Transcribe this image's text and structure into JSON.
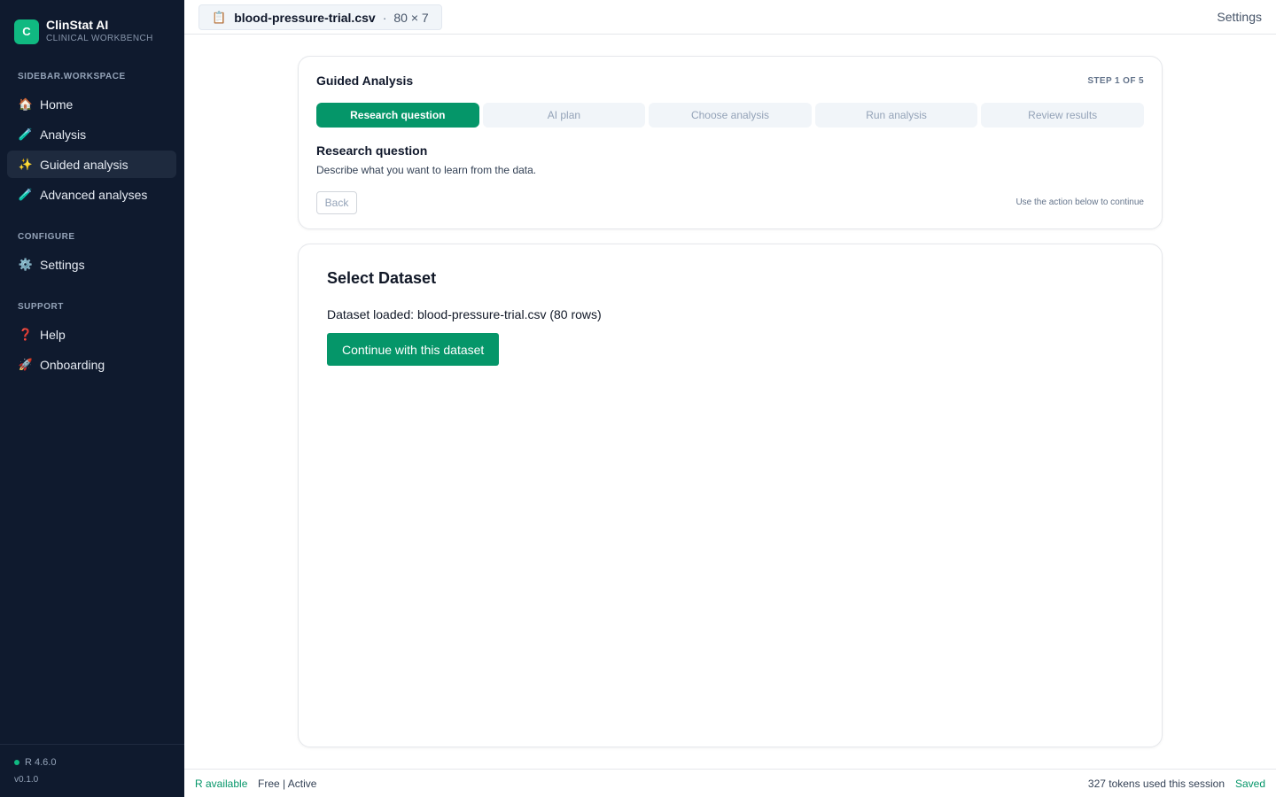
{
  "sidebar": {
    "brand": {
      "logo_letter": "C",
      "title": "ClinStat AI",
      "subtitle": "CLINICAL WORKBENCH"
    },
    "sections": {
      "workspace": "SIDEBAR.WORKSPACE",
      "configure": "CONFIGURE",
      "support": "SUPPORT"
    },
    "items": {
      "home": {
        "label": "Home",
        "icon": "🏠"
      },
      "analysis": {
        "label": "Analysis",
        "icon": "🧪"
      },
      "guided": {
        "label": "Guided analysis",
        "icon": "✨"
      },
      "advanced": {
        "label": "Advanced analyses",
        "icon": "🧪"
      },
      "settings": {
        "label": "Settings",
        "icon": "⚙️"
      },
      "help": {
        "label": "Help",
        "icon": "❓"
      },
      "onboarding": {
        "label": "Onboarding",
        "icon": "🚀"
      }
    },
    "footer": {
      "r_version": "R 4.6.0",
      "app_version": "v0.1.0"
    }
  },
  "topbar": {
    "file_icon": "📋",
    "file_name": "blood-pressure-trial.csv",
    "separator": "·",
    "dims": "80 × 7",
    "settings_label": "Settings"
  },
  "stepper": {
    "title": "Guided Analysis",
    "step_indicator": "STEP 1 OF 5",
    "steps": [
      "Research question",
      "AI plan",
      "Choose analysis",
      "Run analysis",
      "Review results"
    ],
    "heading": "Research question",
    "description": "Describe what you want to learn from the data.",
    "back_label": "Back",
    "hint": "Use the action below to continue"
  },
  "dataset": {
    "title": "Select Dataset",
    "loaded_text": "Dataset loaded: blood-pressure-trial.csv (80 rows)",
    "continue_label": "Continue with this dataset"
  },
  "statusbar": {
    "r_status": "R available",
    "plan": "Free | Active",
    "tokens": "327 tokens used this session",
    "saved": "Saved"
  },
  "colors": {
    "accent": "#059669",
    "sidebar_bg": "#0f1a2e"
  }
}
